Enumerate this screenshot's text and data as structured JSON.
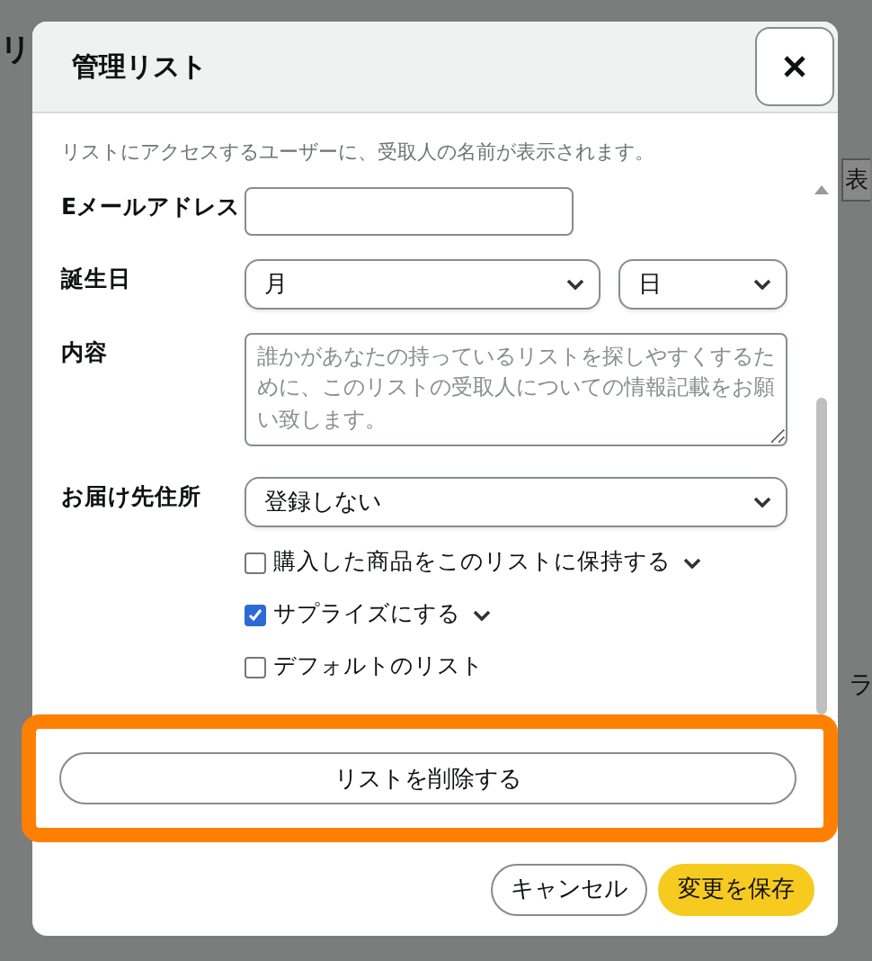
{
  "background": {
    "texts": [
      {
        "kind": "title",
        "text": "リ"
      },
      {
        "kind": "tab",
        "text": "表"
      },
      {
        "kind": "side",
        "text": "ラ"
      }
    ]
  },
  "dialog": {
    "title": "管理リスト",
    "help_text": "リストにアクセスするユーザーに、受取人の名前が表示されます。",
    "fields": [
      {
        "kind": "text",
        "label": "Eメールアドレス"
      },
      {
        "kind": "date",
        "label": "誕生日",
        "selects": [
          "月",
          "日"
        ]
      },
      {
        "kind": "textarea",
        "label": "内容",
        "placeholder": "誰かがあなたの持っているリストを探しやすくするために、このリストの受取人についての情報記載をお願い致します。"
      },
      {
        "kind": "select",
        "label": "お届け先住所",
        "value": "登録しない"
      }
    ],
    "checkboxes": [
      {
        "label": "購入した商品をこのリストに保持する",
        "checked": false,
        "caret": true
      },
      {
        "label": "サプライズにする",
        "checked": true,
        "caret": true
      },
      {
        "label": "デフォルトのリスト",
        "checked": false,
        "caret": false
      }
    ],
    "delete_button": {
      "label": "リストを削除する",
      "highlighted": true
    },
    "buttons": [
      {
        "kind": "secondary",
        "label": "キャンセル"
      },
      {
        "kind": "primary",
        "label": "変更を保存"
      }
    ]
  }
}
